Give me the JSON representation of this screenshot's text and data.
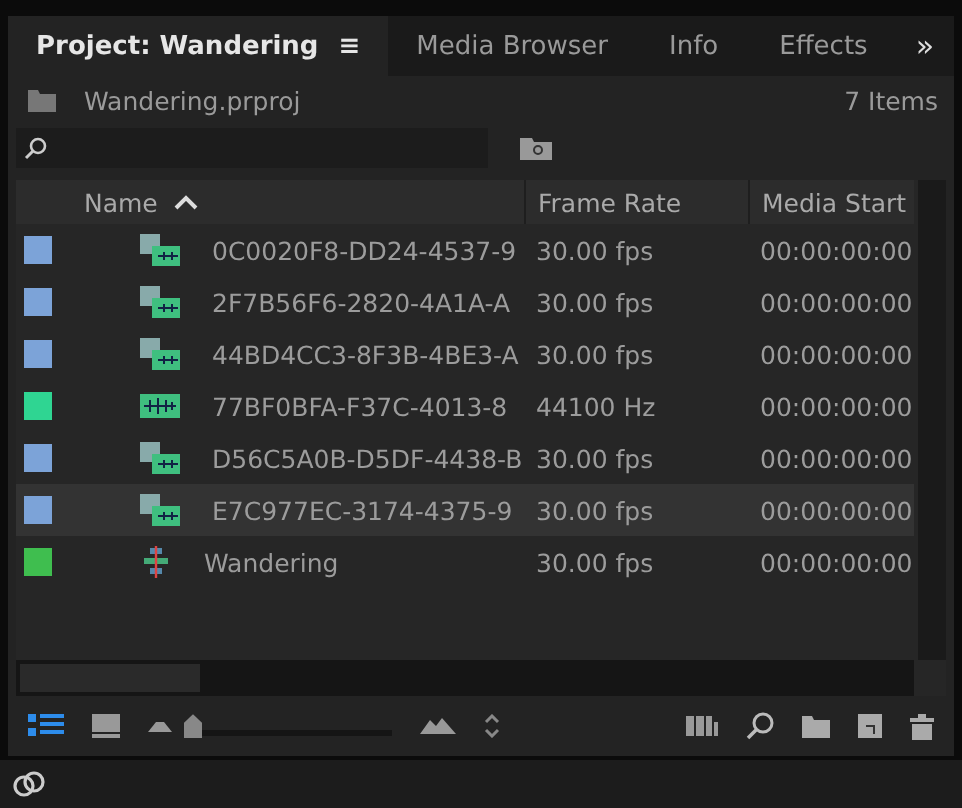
{
  "tabs": [
    {
      "label": "Project: Wandering",
      "selected": true,
      "menu": "≡"
    },
    {
      "label": "Media Browser",
      "selected": false
    },
    {
      "label": "Info",
      "selected": false
    },
    {
      "label": "Effects",
      "selected": false
    }
  ],
  "overflow": "»",
  "project": {
    "file": "Wandering.prproj",
    "count": "7 Items"
  },
  "table": {
    "columns": [
      {
        "label": "Name",
        "sorted": true
      },
      {
        "label": "Frame Rate",
        "sorted": false
      },
      {
        "label": "Media Start",
        "sorted": false
      }
    ],
    "rows": [
      {
        "kind": "video",
        "color": "#7ca3d8",
        "name": "0C0020F8-DD24-4537-9",
        "rate": "30.00 fps",
        "start": "00:00:00:00",
        "selected": false
      },
      {
        "kind": "video",
        "color": "#7ca3d8",
        "name": "2F7B56F6-2820-4A1A-A",
        "rate": "30.00 fps",
        "start": "00:00:00:00",
        "selected": false
      },
      {
        "kind": "video",
        "color": "#7ca3d8",
        "name": "44BD4CC3-8F3B-4BE3-A",
        "rate": "30.00 fps",
        "start": "00:00:00:00",
        "selected": false
      },
      {
        "kind": "audio",
        "color": "#2fd592",
        "name": "77BF0BFA-F37C-4013-8",
        "rate": "44100 Hz",
        "start": "00:00:00:00",
        "selected": false
      },
      {
        "kind": "video",
        "color": "#7ca3d8",
        "name": "D56C5A0B-D5DF-4438-B",
        "rate": "30.00 fps",
        "start": "00:00:00:00",
        "selected": false
      },
      {
        "kind": "video",
        "color": "#7ca3d8",
        "name": "E7C977EC-3174-4375-9",
        "rate": "30.00 fps",
        "start": "00:00:00:00",
        "selected": true
      },
      {
        "kind": "sequence",
        "color": "#3fbe4f",
        "name": "Wandering",
        "rate": "30.00 fps",
        "start": "00:00:00:00",
        "selected": false
      }
    ]
  },
  "toolbar": {
    "list_view": true,
    "zoom": {
      "level": 0.0
    }
  }
}
